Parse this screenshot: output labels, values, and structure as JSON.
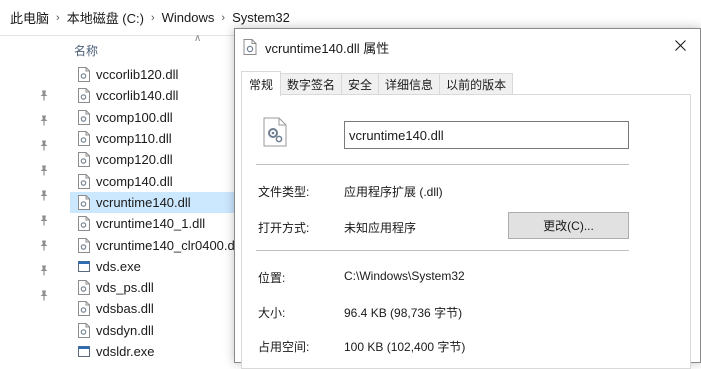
{
  "breadcrumb": [
    "此电脑",
    "本地磁盘 (C:)",
    "Windows",
    "System32"
  ],
  "column_header": "名称",
  "files": [
    {
      "name": "vccorlib120.dll",
      "type": "dll"
    },
    {
      "name": "vccorlib140.dll",
      "type": "dll"
    },
    {
      "name": "vcomp100.dll",
      "type": "dll"
    },
    {
      "name": "vcomp110.dll",
      "type": "dll"
    },
    {
      "name": "vcomp120.dll",
      "type": "dll"
    },
    {
      "name": "vcomp140.dll",
      "type": "dll"
    },
    {
      "name": "vcruntime140.dll",
      "type": "dll",
      "selected": true
    },
    {
      "name": "vcruntime140_1.dll",
      "type": "dll"
    },
    {
      "name": "vcruntime140_clr0400.dll",
      "type": "dll"
    },
    {
      "name": "vds.exe",
      "type": "exe"
    },
    {
      "name": "vds_ps.dll",
      "type": "dll"
    },
    {
      "name": "vdsbas.dll",
      "type": "dll"
    },
    {
      "name": "vdsdyn.dll",
      "type": "dll"
    },
    {
      "name": "vdsldr.exe",
      "type": "exe"
    }
  ],
  "pin_count": 9,
  "dialog": {
    "title": "vcruntime140.dll 属性",
    "tabs": [
      "常规",
      "数字签名",
      "安全",
      "详细信息",
      "以前的版本"
    ],
    "active_tab": 0,
    "file_name": "vcruntime140.dll",
    "file_type_label": "文件类型:",
    "file_type_value": "应用程序扩展 (.dll)",
    "open_with_label": "打开方式:",
    "open_with_value": "未知应用程序",
    "change_button": "更改(C)...",
    "location_label": "位置:",
    "location_value": "C:\\Windows\\System32",
    "size_label": "大小:",
    "size_value": "96.4 KB (98,736 字节)",
    "disk_size_label": "占用空间:",
    "disk_size_value": "100 KB (102,400 字节)"
  },
  "colors": {
    "selection": "#cce8ff",
    "column_header_text": "#4c607a"
  }
}
